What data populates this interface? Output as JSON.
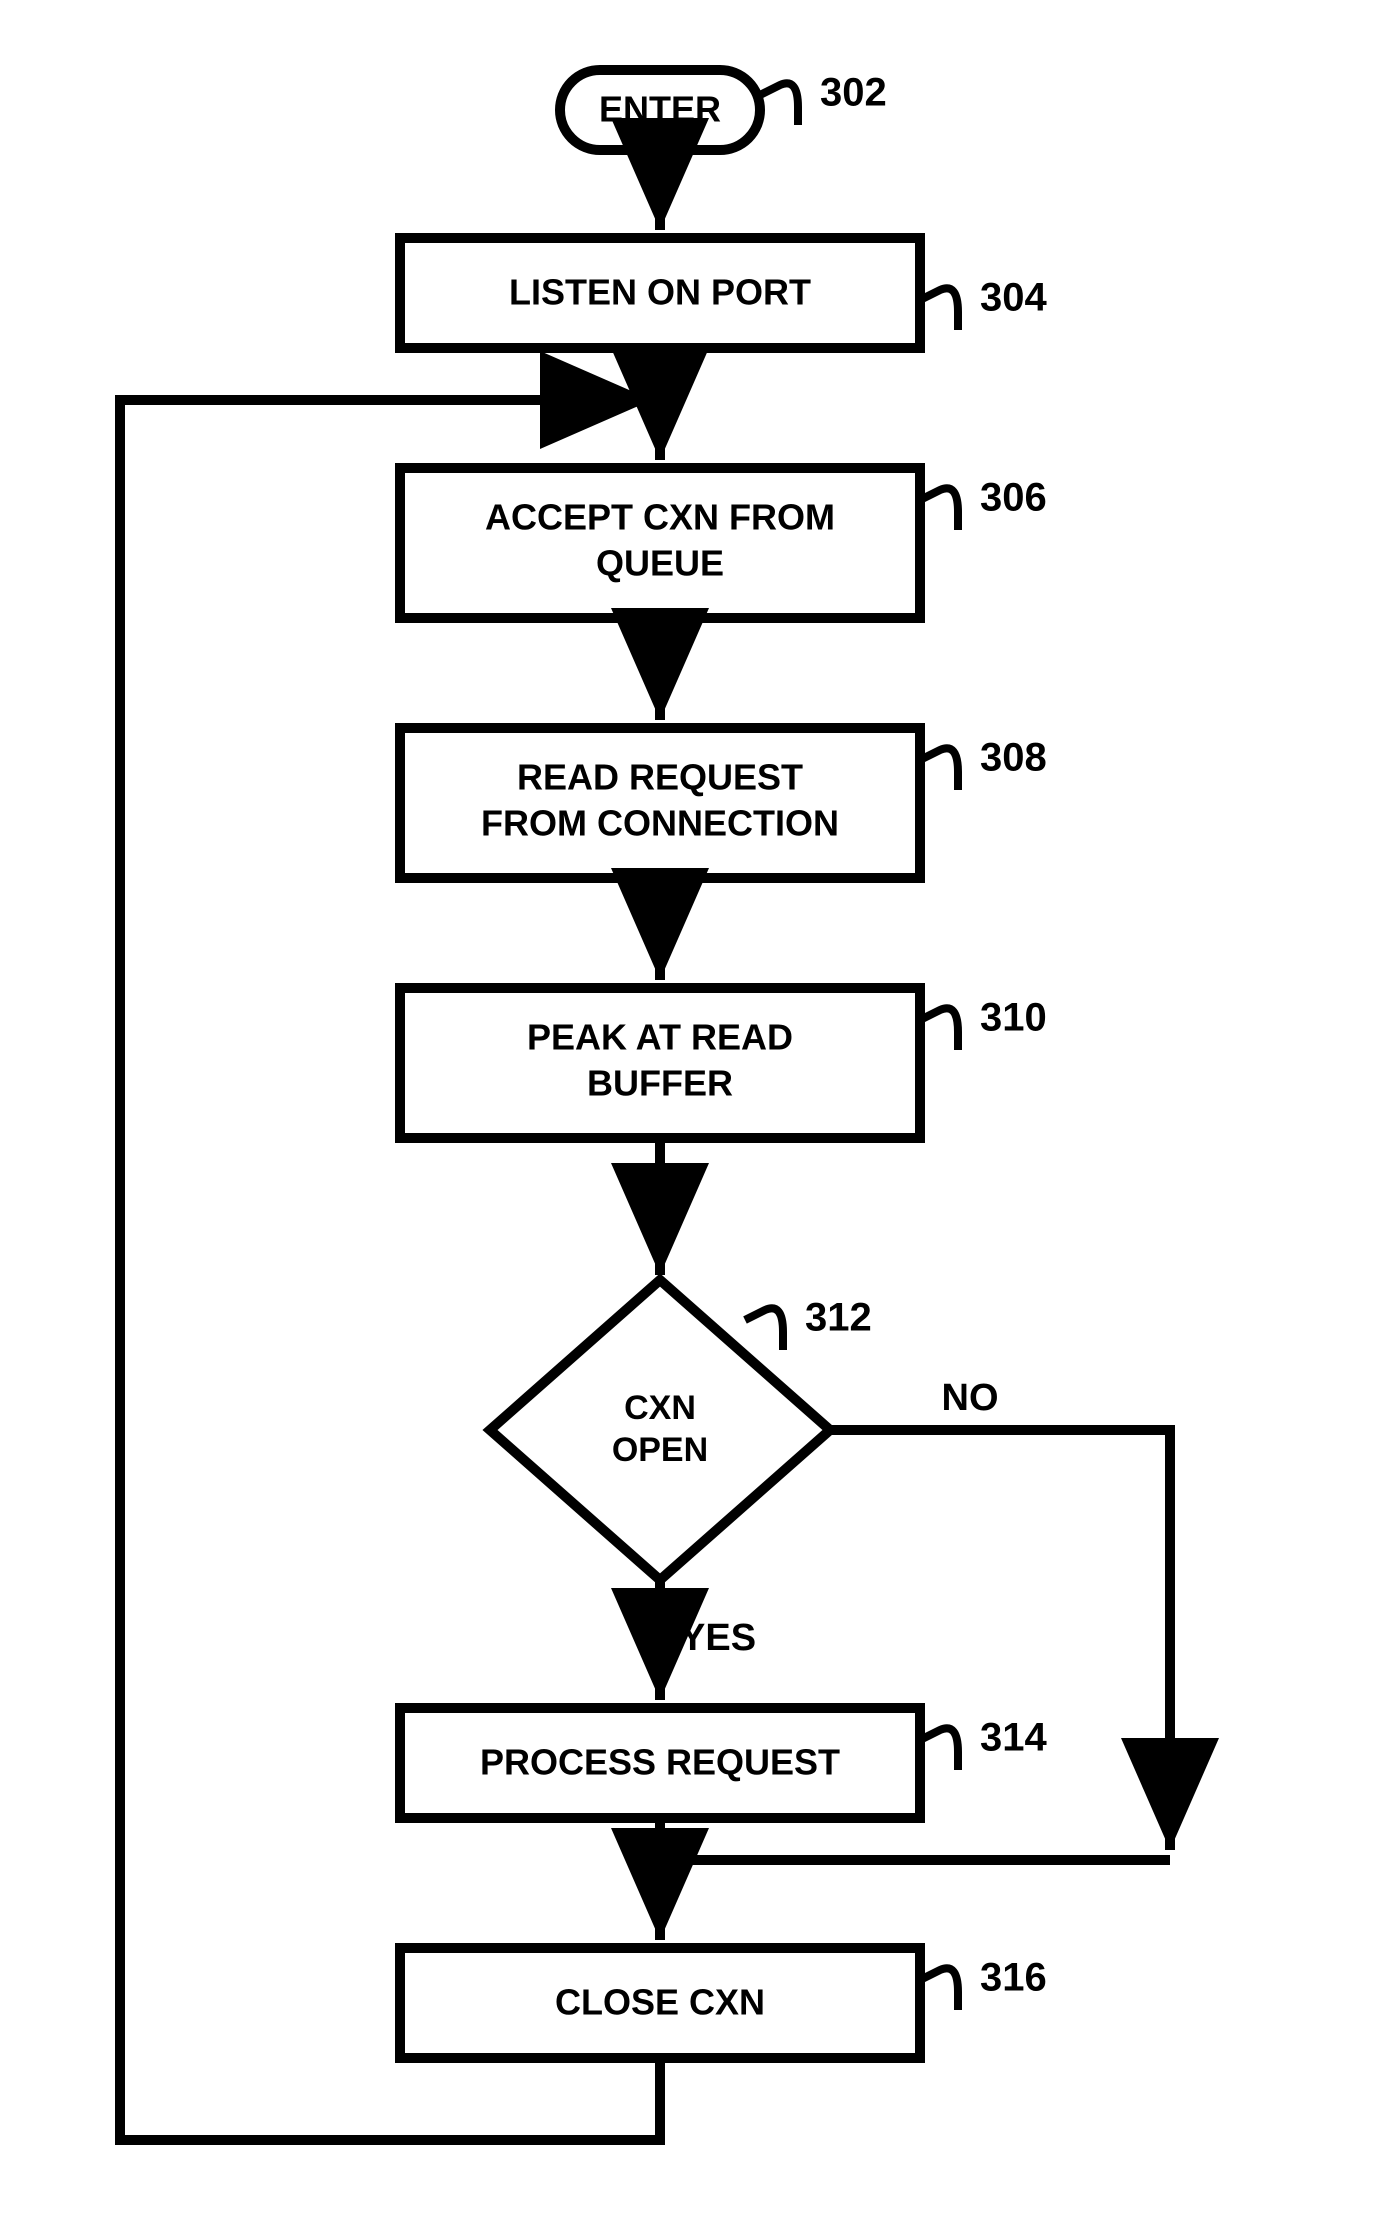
{
  "nodes": {
    "enter": {
      "label": "ENTER",
      "ref": "302"
    },
    "listen": {
      "label": "LISTEN ON PORT",
      "ref": "304"
    },
    "accept": {
      "line1": "ACCEPT CXN FROM",
      "line2": "QUEUE",
      "ref": "306"
    },
    "read": {
      "line1": "READ REQUEST",
      "line2": "FROM CONNECTION",
      "ref": "308"
    },
    "peak": {
      "line1": "PEAK AT READ",
      "line2": "BUFFER",
      "ref": "310"
    },
    "decision": {
      "line1": "CXN",
      "line2": "OPEN",
      "ref": "312"
    },
    "process": {
      "label": "PROCESS REQUEST",
      "ref": "314"
    },
    "close": {
      "label": "CLOSE CXN",
      "ref": "316"
    }
  },
  "edges": {
    "yes": "YES",
    "no": "NO"
  }
}
